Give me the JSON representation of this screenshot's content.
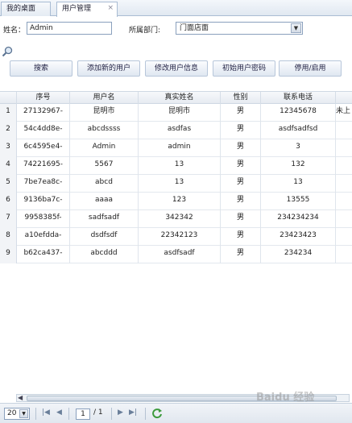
{
  "tabs": [
    {
      "label": "我的桌面"
    },
    {
      "label": "用户管理",
      "close": "×"
    }
  ],
  "search": {
    "name_label": "姓名：",
    "name_value": "Admin",
    "dept_label": "所属部门:",
    "dept_value": "门面店面"
  },
  "toolbar": {
    "search_label": "搜索",
    "add_label": "添加新的用户",
    "edit_label": "修改用户信息",
    "init_pwd_label": "初始用户密码",
    "toggle_label": "停用/启用"
  },
  "grid": {
    "headers": [
      "序号",
      "用户名",
      "真实姓名",
      "性别",
      "联系电话"
    ],
    "rows": [
      {
        "num": "1",
        "id": "27132967-",
        "username": "昆明市",
        "realname": "昆明市",
        "gender": "男",
        "phone": "12345678",
        "extra": "未上"
      },
      {
        "num": "2",
        "id": "54c4dd8e-",
        "username": "abcdssss",
        "realname": "asdfas",
        "gender": "男",
        "phone": "asdfsadfsd",
        "extra": ""
      },
      {
        "num": "3",
        "id": "6c4595e4-",
        "username": "Admin",
        "realname": "admin",
        "gender": "男",
        "phone": "3",
        "extra": ""
      },
      {
        "num": "4",
        "id": "74221695-",
        "username": "5567",
        "realname": "13",
        "gender": "男",
        "phone": "132",
        "extra": ""
      },
      {
        "num": "5",
        "id": "7be7ea8c-",
        "username": "abcd",
        "realname": "13",
        "gender": "男",
        "phone": "13",
        "extra": ""
      },
      {
        "num": "6",
        "id": "9136ba7c-",
        "username": "aaaa",
        "realname": "123",
        "gender": "男",
        "phone": "13555",
        "extra": ""
      },
      {
        "num": "7",
        "id": "9958385f-",
        "username": "sadfsadf",
        "realname": "342342",
        "gender": "男",
        "phone": "234234234",
        "extra": ""
      },
      {
        "num": "8",
        "id": "a10efdda-",
        "username": "dsdfsdf",
        "realname": "22342123",
        "gender": "男",
        "phone": "23423423",
        "extra": ""
      },
      {
        "num": "9",
        "id": "b62ca437-",
        "username": "abcddd",
        "realname": "asdfsadf",
        "gender": "男",
        "phone": "234234",
        "extra": ""
      }
    ]
  },
  "pager": {
    "page_size": "20",
    "current_page": "1",
    "total_pages": "/ 1"
  },
  "watermark": "Baidu 经验"
}
